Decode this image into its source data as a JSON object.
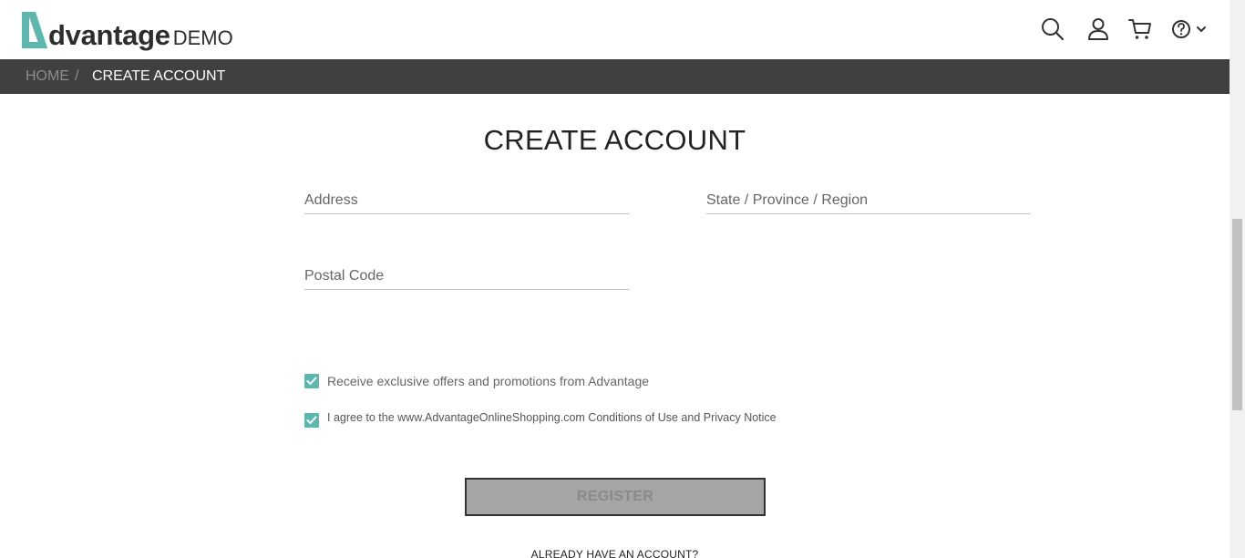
{
  "header": {
    "logo_text": "dvantage",
    "logo_demo": "DEMO",
    "icons": [
      "search-icon",
      "user-icon",
      "cart-icon",
      "help-icon",
      "chevron-down-icon"
    ]
  },
  "breadcrumb": {
    "home": "HOME",
    "separator": "/",
    "current": "CREATE ACCOUNT"
  },
  "form": {
    "title": "CREATE ACCOUNT",
    "address_placeholder": "Address",
    "state_placeholder": "State / Province / Region",
    "postal_placeholder": "Postal Code",
    "offers_label": "Receive exclusive offers and promotions from Advantage",
    "offers_checked": true,
    "agree_label": "I agree to the www.AdvantageOnlineShopping.com Conditions of Use and Privacy Notice",
    "agree_checked": true,
    "register_label": "REGISTER",
    "already_label": "ALREADY HAVE AN ACCOUNT?"
  },
  "colors": {
    "accent": "#5cb8ad",
    "breadcrumb_bg": "#404040",
    "register_bg": "#a5a5a5"
  }
}
